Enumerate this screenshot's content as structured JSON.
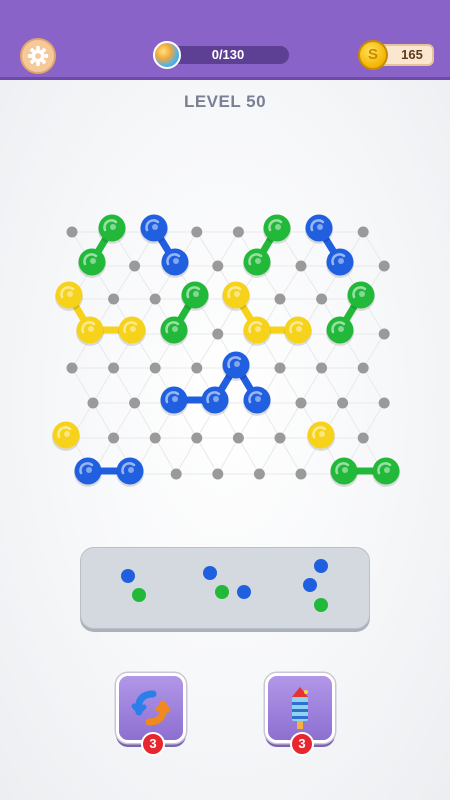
{
  "header": {
    "settings_icon": "gear-icon",
    "progress_text": "0/130",
    "progress_fraction": 0,
    "coins": "165",
    "coin_symbol": "S"
  },
  "level_title": "LEVEL 50",
  "colors": {
    "blue": "#1f5fe0",
    "green": "#22b83a",
    "yellow": "#f7d21a",
    "grid_dot": "#9a9a9a",
    "accent_purple": "#8a63c9"
  },
  "boosters": [
    {
      "icon": "swap-arrows-icon",
      "count": "3"
    },
    {
      "icon": "rocket-icon",
      "count": "3"
    }
  ]
}
